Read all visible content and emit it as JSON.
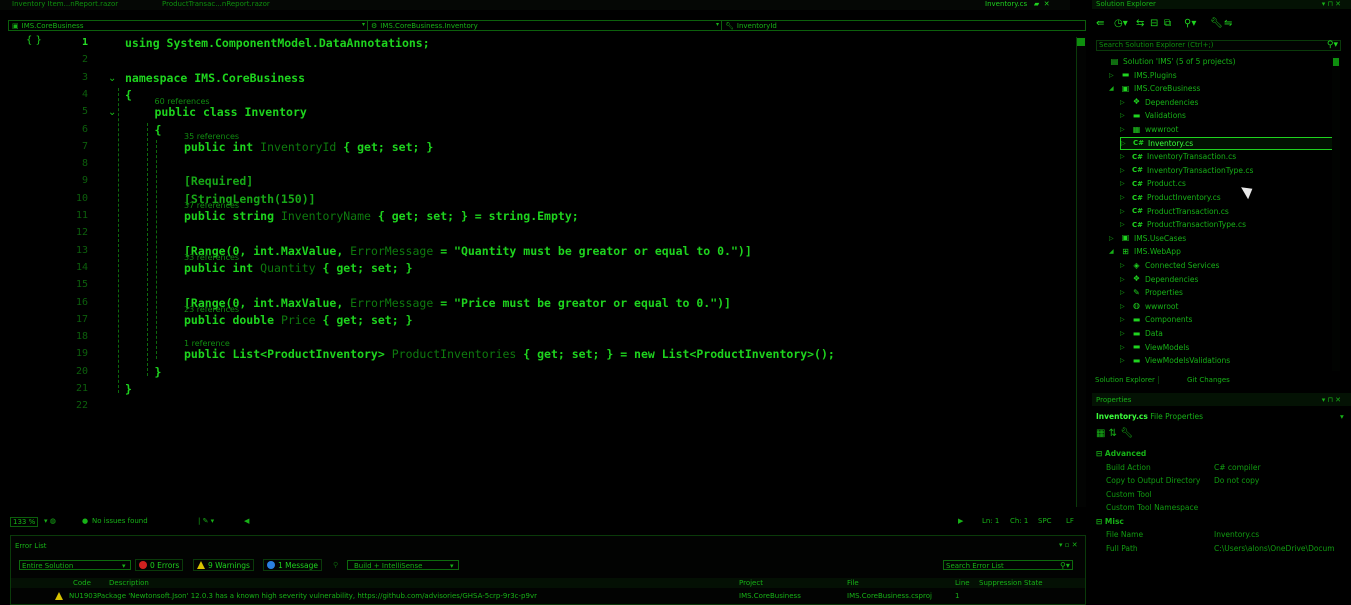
{
  "doc_tabs": [
    "Inventory Item...nReport.razor",
    "ProductTransac...nReport.razor"
  ],
  "editor_tab_right": "Inventory.cs",
  "nav_bar": {
    "project": "IMS.CoreBusiness",
    "class": "IMS.CoreBusiness.Inventory",
    "member": "InventoryId"
  },
  "code": {
    "lines": [
      {
        "n": "1",
        "text": "using System.ComponentModel.DataAnnotations;"
      },
      {
        "n": "2",
        "text": ""
      },
      {
        "n": "3",
        "text": "namespace IMS.CoreBusiness"
      },
      {
        "n": "4",
        "text": "{"
      },
      {
        "n": "5",
        "refs": "60 references",
        "text": "public class Inventory"
      },
      {
        "n": "6",
        "text": "{"
      },
      {
        "n": "7",
        "refs": "35 references",
        "kw": "public int ",
        "ident": "InventoryId",
        "rest": " { get; set; }"
      },
      {
        "n": "8",
        "text": ""
      },
      {
        "n": "9",
        "text": "[Required]"
      },
      {
        "n": "10",
        "text": "[StringLength(150)]"
      },
      {
        "n": "11",
        "refs": "37 references",
        "kw": "public string ",
        "ident": "InventoryName",
        "rest": " { get; set; } = string.Empty;"
      },
      {
        "n": "12",
        "text": ""
      },
      {
        "n": "13",
        "pre": "[Range(0, int.MaxValue, ",
        "ident": "ErrorMessage",
        "rest": " = \"Quantity must be greator or equal to 0.\")]"
      },
      {
        "n": "14",
        "refs": "33 references",
        "kw": "public int ",
        "ident": "Quantity",
        "rest": " { get; set; }"
      },
      {
        "n": "15",
        "text": ""
      },
      {
        "n": "16",
        "pre": "[Range(0, int.MaxValue, ",
        "ident": "ErrorMessage",
        "rest": " = \"Price must be greator or equal to 0.\")]"
      },
      {
        "n": "17",
        "refs": "23 references",
        "kw": "public double ",
        "ident": "Price",
        "rest": " { get; set; }"
      },
      {
        "n": "18",
        "text": ""
      },
      {
        "n": "19",
        "refs": "1 reference",
        "kw": "public List<ProductInventory> ",
        "ident": "ProductInventories",
        "rest": " { get; set; } = new List<ProductInventory>();"
      },
      {
        "n": "20",
        "text": "}"
      },
      {
        "n": "21",
        "text": "}"
      },
      {
        "n": "22",
        "text": ""
      }
    ]
  },
  "editor_status": {
    "zoom": "133 %",
    "issues": "No issues found",
    "ln": "Ln: 1",
    "ch": "Ch: 1",
    "spc": "SPC",
    "lf": "LF"
  },
  "error_list": {
    "title": "Error List",
    "scope": "Entire Solution",
    "errors": "0 Errors",
    "warnings": "9 Warnings",
    "messages": "1 Message",
    "build_filter": "Build + IntelliSense",
    "search_placeholder": "Search Error List",
    "columns": [
      "Code",
      "Description",
      "Project",
      "File",
      "Line",
      "Suppression State"
    ],
    "row": {
      "code": "NU1903",
      "description": "Package 'Newtonsoft.Json' 12.0.3 has a known high severity vulnerability, https://github.com/advisories/GHSA-5crp-9r3c-p9vr",
      "project": "IMS.CoreBusiness",
      "file": "IMS.CoreBusiness.csproj",
      "line": "1"
    }
  },
  "solution_explorer": {
    "title": "Solution Explorer",
    "search_placeholder": "Search Solution Explorer (Ctrl+;)",
    "items": [
      {
        "label": "Solution 'IMS' (5 of 5 projects)",
        "indent": 0,
        "exp": "",
        "icon": "solution"
      },
      {
        "label": "IMS.Plugins",
        "indent": 1,
        "exp": "▷",
        "icon": "folder"
      },
      {
        "label": "IMS.CoreBusiness",
        "indent": 1,
        "exp": "◢",
        "icon": "project"
      },
      {
        "label": "Dependencies",
        "indent": 2,
        "exp": "▷",
        "icon": "deps"
      },
      {
        "label": "Validations",
        "indent": 2,
        "exp": "▷",
        "icon": "folder"
      },
      {
        "label": "wwwroot",
        "indent": 2,
        "exp": "▷",
        "icon": "web"
      },
      {
        "label": "Inventory.cs",
        "indent": 2,
        "exp": "▷",
        "icon": "cs",
        "selected": true
      },
      {
        "label": "InventoryTransaction.cs",
        "indent": 2,
        "exp": "▷",
        "icon": "cs"
      },
      {
        "label": "InventoryTransactionType.cs",
        "indent": 2,
        "exp": "▷",
        "icon": "cs"
      },
      {
        "label": "Product.cs",
        "indent": 2,
        "exp": "▷",
        "icon": "cs"
      },
      {
        "label": "ProductInventory.cs",
        "indent": 2,
        "exp": "▷",
        "icon": "cs"
      },
      {
        "label": "ProductTransaction.cs",
        "indent": 2,
        "exp": "▷",
        "icon": "cs"
      },
      {
        "label": "ProductTransactionType.cs",
        "indent": 2,
        "exp": "▷",
        "icon": "cs"
      },
      {
        "label": "IMS.UseCases",
        "indent": 1,
        "exp": "▷",
        "icon": "project"
      },
      {
        "label": "IMS.WebApp",
        "indent": 1,
        "exp": "◢",
        "icon": "webproject"
      },
      {
        "label": "Connected Services",
        "indent": 2,
        "exp": "▷",
        "icon": "connected"
      },
      {
        "label": "Dependencies",
        "indent": 2,
        "exp": "▷",
        "icon": "deps"
      },
      {
        "label": "Properties",
        "indent": 2,
        "exp": "▷",
        "icon": "props"
      },
      {
        "label": "wwwroot",
        "indent": 2,
        "exp": "▷",
        "icon": "globe"
      },
      {
        "label": "Components",
        "indent": 2,
        "exp": "▷",
        "icon": "folder"
      },
      {
        "label": "Data",
        "indent": 2,
        "exp": "▷",
        "icon": "folder"
      },
      {
        "label": "ViewModels",
        "indent": 2,
        "exp": "▷",
        "icon": "folder"
      },
      {
        "label": "ViewModelsValidations",
        "indent": 2,
        "exp": "▷",
        "icon": "folder"
      }
    ],
    "bottom_tabs": [
      "Solution Explorer",
      "Git Changes"
    ]
  },
  "properties": {
    "title": "Properties",
    "subject_name": "Inventory.cs",
    "subject_type": "File Properties",
    "sections": [
      {
        "name": "Advanced",
        "rows": [
          {
            "k": "Build Action",
            "v": "C# compiler"
          },
          {
            "k": "Copy to Output Directory",
            "v": "Do not copy"
          },
          {
            "k": "Custom Tool",
            "v": ""
          },
          {
            "k": "Custom Tool Namespace",
            "v": ""
          }
        ]
      },
      {
        "name": "Misc",
        "rows": [
          {
            "k": "File Name",
            "v": "Inventory.cs"
          },
          {
            "k": "Full Path",
            "v": "C:\\Users\\alons\\OneDrive\\Docum"
          }
        ]
      }
    ]
  }
}
